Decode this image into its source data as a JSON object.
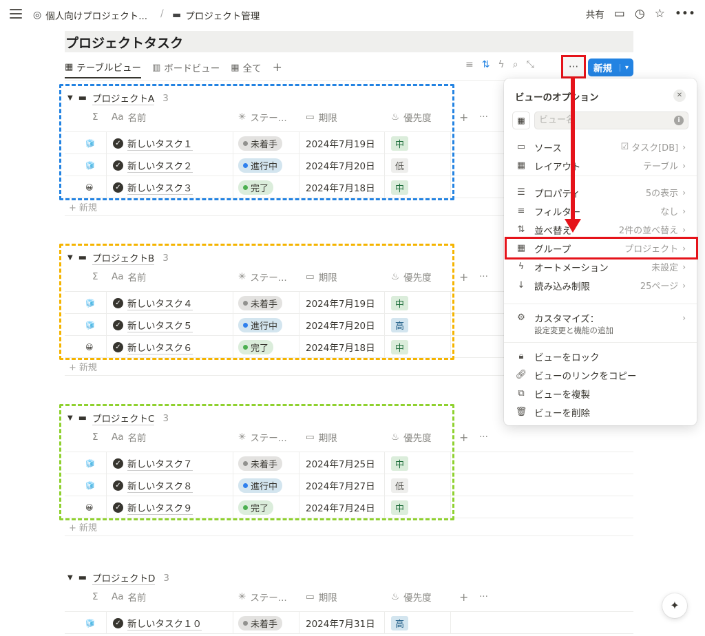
{
  "breadcrumb": {
    "workspace": "個人向けプロジェクト...",
    "separator": "/",
    "page": "プロジェクト管理"
  },
  "topbar": {
    "share": "共有",
    "icons": [
      "comment-icon",
      "clock-icon",
      "star-icon",
      "more-icon"
    ]
  },
  "page_title": "プロジェクトタスク",
  "views": [
    {
      "label": "テーブルビュー",
      "icon": "table-icon"
    },
    {
      "label": "ボードビュー",
      "icon": "board-icon"
    },
    {
      "label": "全て",
      "icon": "table-icon"
    }
  ],
  "toolbar": {
    "add_view": "+",
    "more": "···",
    "new_label": "新規",
    "new_dropdown": "⌄"
  },
  "columns": {
    "sigma": "Σ",
    "name": "名前",
    "name_prefix": "Aa",
    "status": "ステー...",
    "date": "期限",
    "priority": "優先度",
    "add": "+",
    "more": "···"
  },
  "new_row_label": "新規",
  "groups": [
    {
      "name": "プロジェクトA",
      "count": "3",
      "border_color": "#2383e2",
      "rows": [
        {
          "icon": "🧊",
          "name": "新しいタスク１",
          "status": "未着手",
          "status_style": "todo",
          "date": "2024年7月19日",
          "priority": "中",
          "priority_style": "mid"
        },
        {
          "icon": "🧊",
          "name": "新しいタスク２",
          "status": "進行中",
          "status_style": "doing",
          "date": "2024年7月20日",
          "priority": "低",
          "priority_style": "low"
        },
        {
          "icon": "😀",
          "name": "新しいタスク３",
          "status": "完了",
          "status_style": "done",
          "date": "2024年7月18日",
          "priority": "中",
          "priority_style": "mid"
        }
      ]
    },
    {
      "name": "プロジェクトB",
      "count": "3",
      "border_color": "#f5b400",
      "rows": [
        {
          "icon": "🧊",
          "name": "新しいタスク４",
          "status": "未着手",
          "status_style": "todo",
          "date": "2024年7月19日",
          "priority": "中",
          "priority_style": "mid"
        },
        {
          "icon": "🧊",
          "name": "新しいタスク５",
          "status": "進行中",
          "status_style": "doing",
          "date": "2024年7月20日",
          "priority": "高",
          "priority_style": "high"
        },
        {
          "icon": "😀",
          "name": "新しいタスク６",
          "status": "完了",
          "status_style": "done",
          "date": "2024年7月18日",
          "priority": "中",
          "priority_style": "mid"
        }
      ]
    },
    {
      "name": "プロジェクトC",
      "count": "3",
      "border_color": "#8fd12f",
      "rows": [
        {
          "icon": "🧊",
          "name": "新しいタスク７",
          "status": "未着手",
          "status_style": "todo",
          "date": "2024年7月25日",
          "priority": "中",
          "priority_style": "mid"
        },
        {
          "icon": "🧊",
          "name": "新しいタスク８",
          "status": "進行中",
          "status_style": "doing",
          "date": "2024年7月27日",
          "priority": "低",
          "priority_style": "low"
        },
        {
          "icon": "😀",
          "name": "新しいタスク９",
          "status": "完了",
          "status_style": "done",
          "date": "2024年7月24日",
          "priority": "中",
          "priority_style": "mid"
        }
      ]
    },
    {
      "name": "プロジェクトD",
      "count": "3",
      "border_color": "",
      "rows": [
        {
          "icon": "🧊",
          "name": "新しいタスク１０",
          "status": "未着手",
          "status_style": "todo",
          "date": "2024年7月31日",
          "priority": "高",
          "priority_style": "high"
        }
      ]
    }
  ],
  "view_options": {
    "title": "ビューのオプション",
    "close": "✕",
    "name_placeholder": "ビュー名",
    "info": "i",
    "items": [
      {
        "icon": "folder-icon",
        "glyph": "▭",
        "label": "ソース",
        "value": "タスク[DB]",
        "value_icon": "☑"
      },
      {
        "icon": "table-icon",
        "glyph": "▦",
        "label": "レイアウト",
        "value": "テーブル"
      },
      {
        "icon": "list-icon",
        "glyph": "☰",
        "label": "プロパティ",
        "value": "5の表示"
      },
      {
        "icon": "filter-icon",
        "glyph": "≡",
        "label": "フィルター",
        "value": "なし"
      },
      {
        "icon": "sort-icon",
        "glyph": "⇅",
        "label": "並べ替え",
        "value": "2件の並べ替え"
      },
      {
        "icon": "group-icon",
        "glyph": "▦",
        "label": "グループ",
        "value": "プロジェクト"
      },
      {
        "icon": "bolt-icon",
        "glyph": "ϟ",
        "label": "オートメーション",
        "value": "未設定"
      },
      {
        "icon": "arrow-down-icon",
        "glyph": "↓",
        "label": "読み込み制限",
        "value": "25ページ"
      },
      {
        "icon": "gear-icon",
        "glyph": "⚙",
        "label": "カスタマイズ：",
        "value": ""
      },
      {
        "icon": "lock-icon",
        "glyph": "🔒︎",
        "label": "ビューをロック",
        "value": ""
      },
      {
        "icon": "link-icon",
        "glyph": "🔗︎",
        "label": "ビューのリンクをコピー",
        "value": ""
      },
      {
        "icon": "copy-icon",
        "glyph": "⧉",
        "label": "ビューを複製",
        "value": ""
      },
      {
        "icon": "trash-icon",
        "glyph": "🗑︎",
        "label": "ビューを削除",
        "value": ""
      }
    ],
    "customize_sub": "設定変更と機能の追加"
  },
  "colors": {
    "accent": "#2383e2",
    "highlight_red": "#e5131a",
    "status_todo_bg": "#e3e2e0",
    "status_doing_bg": "#d3e5ef",
    "status_done_bg": "#dbeddb",
    "priority_mid_bg": "#dbeddb",
    "priority_low_bg": "#eeeeec",
    "priority_high_bg": "#d3e5ef"
  }
}
